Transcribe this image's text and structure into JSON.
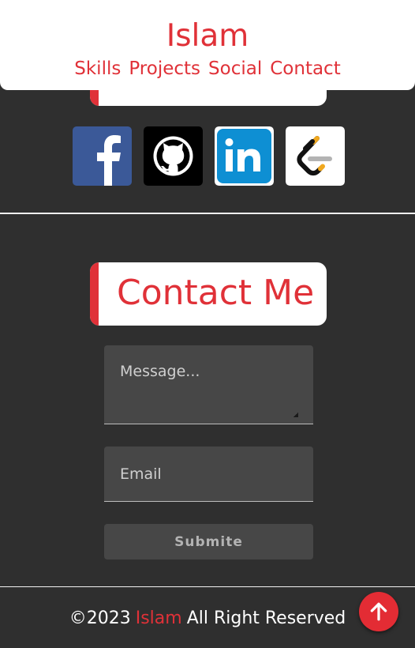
{
  "header": {
    "brand": "Islam",
    "nav": [
      "Skills",
      "Projects",
      "Social",
      "Contact"
    ]
  },
  "social": {
    "icons": [
      "facebook-icon",
      "github-icon",
      "linkedin-icon",
      "leetcode-icon"
    ]
  },
  "contact": {
    "title": "Contact Me",
    "message_placeholder": "Message...",
    "email_placeholder": "Email",
    "submit_label": "Submite"
  },
  "footer": {
    "copyright": "©2023",
    "name": "Islam",
    "rights": "All Right Reserved"
  },
  "colors": {
    "accent": "#e03138",
    "background": "#2f2f2f",
    "field": "#474747"
  }
}
